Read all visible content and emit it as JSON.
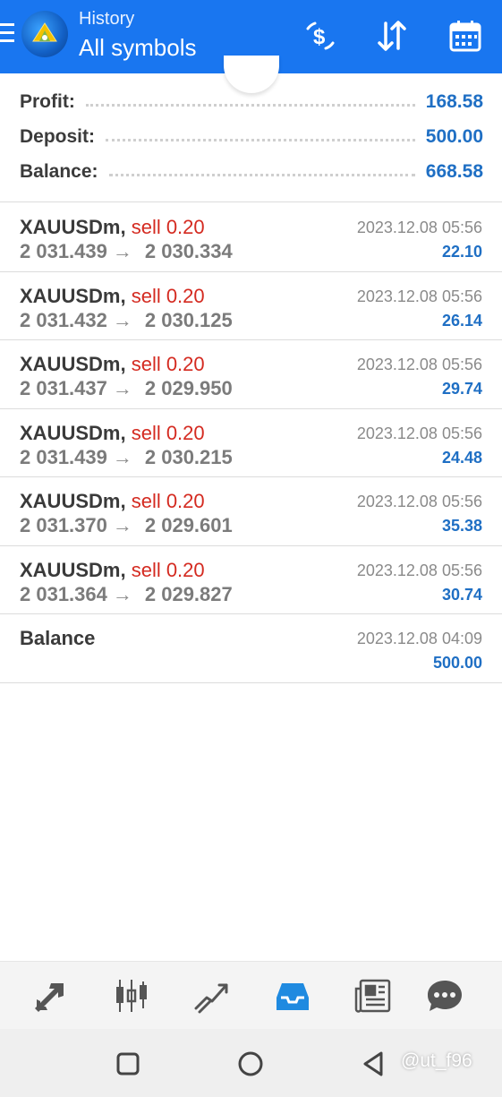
{
  "header": {
    "subtitle": "History",
    "title": "All symbols",
    "background": "#1976f0"
  },
  "summary": {
    "profit_label": "Profit:",
    "profit_value": "168.58",
    "deposit_label": "Deposit:",
    "deposit_value": "500.00",
    "balance_label": "Balance:",
    "balance_value": "668.58"
  },
  "deals": [
    {
      "symbol": "XAUUSDm,",
      "side": "sell 0.20",
      "open": "2 031.439",
      "arrow": "→",
      "close": "2 030.334",
      "time": "2023.12.08 05:56",
      "profit": "22.10"
    },
    {
      "symbol": "XAUUSDm,",
      "side": "sell 0.20",
      "open": "2 031.432",
      "arrow": "→",
      "close": "2 030.125",
      "time": "2023.12.08 05:56",
      "profit": "26.14"
    },
    {
      "symbol": "XAUUSDm,",
      "side": "sell 0.20",
      "open": "2 031.437",
      "arrow": "→",
      "close": "2 029.950",
      "time": "2023.12.08 05:56",
      "profit": "29.74"
    },
    {
      "symbol": "XAUUSDm,",
      "side": "sell 0.20",
      "open": "2 031.439",
      "arrow": "→",
      "close": "2 030.215",
      "time": "2023.12.08 05:56",
      "profit": "24.48"
    },
    {
      "symbol": "XAUUSDm,",
      "side": "sell 0.20",
      "open": "2 031.370",
      "arrow": "→",
      "close": "2 029.601",
      "time": "2023.12.08 05:56",
      "profit": "35.38"
    },
    {
      "symbol": "XAUUSDm,",
      "side": "sell 0.20",
      "open": "2 031.364",
      "arrow": "→",
      "close": "2 029.827",
      "time": "2023.12.08 05:56",
      "profit": "30.74"
    }
  ],
  "balance_op": {
    "label": "Balance",
    "time": "2023.12.08 04:09",
    "amount": "500.00"
  },
  "tabs": [
    "quotes-icon",
    "chart-icon",
    "trade-icon",
    "history-icon",
    "news-icon",
    "chat-icon"
  ],
  "active_tab_color": "#1f8ae0",
  "watermark": "@ut_f96"
}
